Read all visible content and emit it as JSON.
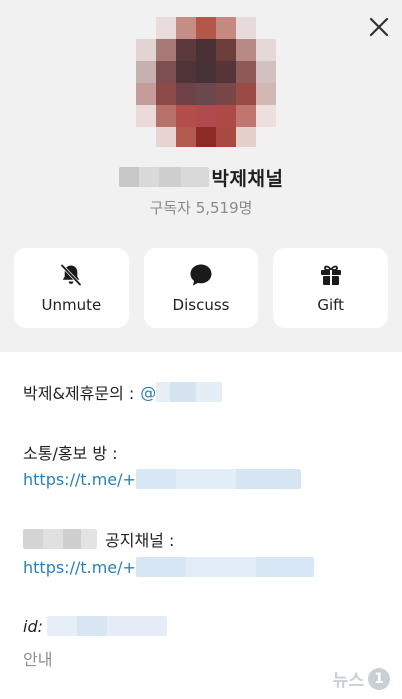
{
  "header": {
    "channel_title": "박제채널",
    "subscribers": "구독자 5,519명"
  },
  "icons": {
    "close": "close-icon",
    "unmute": "bell-muted-icon",
    "discuss": "chat-bubble-icon",
    "gift": "gift-icon"
  },
  "actions": {
    "unmute_label": "Unmute",
    "discuss_label": "Discuss",
    "gift_label": "Gift"
  },
  "info": {
    "contact_label": "박제&제휴문의 :",
    "contact_handle_visible": "@",
    "promo_room_label": "소통/홍보 방 :",
    "promo_link_visible": "https://t.me/+",
    "notice_label": "공지채널 :",
    "notice_link_visible": "https://t.me/+",
    "id_label": "id:",
    "guide_text": "안내"
  },
  "watermark": {
    "text": "뉴스",
    "badge": "1"
  },
  "colors": {
    "header_bg": "#f1f1f1",
    "card_bg": "#ffffff",
    "link": "#2a7fb8",
    "muted": "#8a8a8a"
  }
}
